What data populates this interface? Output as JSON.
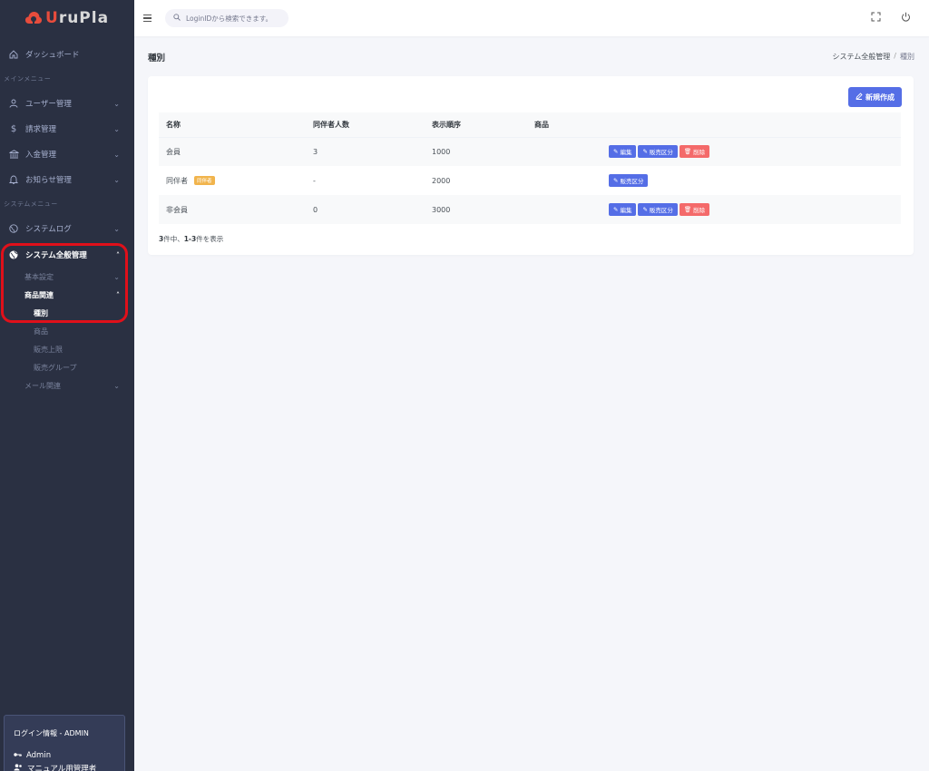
{
  "logo": {
    "text_u": "U",
    "text_rest": "ruPla"
  },
  "sidebar": {
    "dashboard": "ダッシュボード",
    "main_menu_section": "メインメニュー",
    "user_mgmt": "ユーザー管理",
    "billing": "請求管理",
    "deposit": "入金管理",
    "notice": "お知らせ管理",
    "system_menu_section": "システムメニュー",
    "system_log": "システムログ",
    "system_general": "システム全般管理",
    "basic_settings": "基本設定",
    "product_related": "商品関連",
    "type": "種別",
    "product": "商品",
    "sales_limit": "販売上限",
    "sales_group": "販売グループ",
    "mail_related": "メール関連"
  },
  "login": {
    "title": "ログイン情報 - ADMIN",
    "user": "Admin",
    "role": "マニュアル用管理者"
  },
  "search": {
    "placeholder": "LoginIDから検索できます。"
  },
  "page": {
    "title": "種別",
    "breadcrumb": [
      "システム全般管理",
      "種別"
    ]
  },
  "new_button": "新規作成",
  "table": {
    "headers": [
      "名称",
      "同伴者人数",
      "表示順序",
      "商品"
    ],
    "rows": [
      {
        "name": "会員",
        "badge": "",
        "companions": "3",
        "order": "1000",
        "buttons": [
          "編集",
          "販売区分",
          "削除"
        ]
      },
      {
        "name": "同伴者",
        "badge": "同伴者",
        "companions": "-",
        "order": "2000",
        "buttons": [
          "販売区分"
        ]
      },
      {
        "name": "非会員",
        "badge": "",
        "companions": "0",
        "order": "3000",
        "buttons": [
          "編集",
          "販売区分",
          "削除"
        ]
      }
    ]
  },
  "count": {
    "total": "3",
    "mid": "件中、",
    "range": "1-3",
    "suffix": "件を表示"
  },
  "colors": {
    "primary": "#556ee6",
    "danger": "#f46a6a",
    "warning": "#f1b44c",
    "sidebar": "#2a3042",
    "highlight": "#e0101a"
  }
}
